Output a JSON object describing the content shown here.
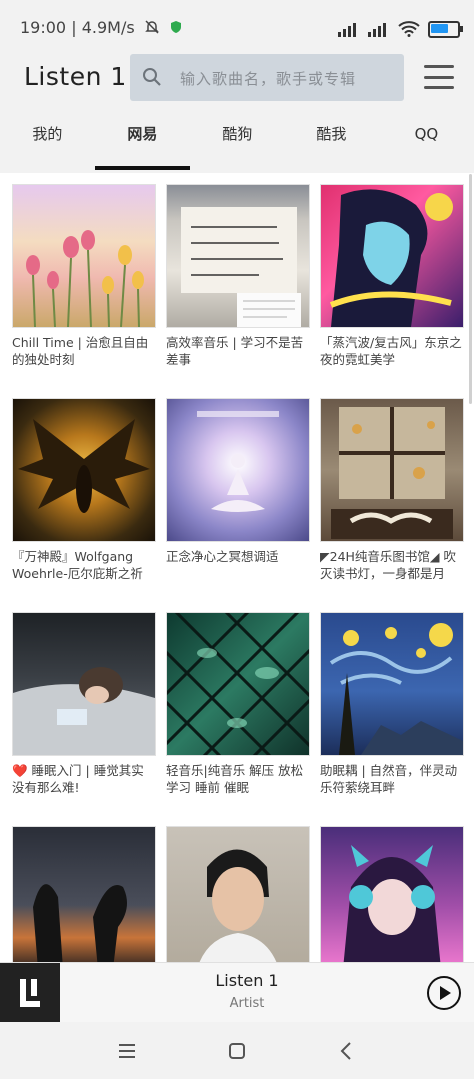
{
  "status": {
    "time": "19:00",
    "speed": "4.9M/s",
    "battery_level": 0.7
  },
  "header": {
    "title": "Listen 1",
    "search_placeholder": "输入歌曲名，歌手或专辑"
  },
  "tabs": [
    "我的",
    "网易",
    "酷狗",
    "酷我",
    "QQ"
  ],
  "active_tab": "网易",
  "playlists": [
    {
      "title": "Chill Time | 治愈且自由的独处时刻",
      "icon": "tulip-field"
    },
    {
      "title": "高效率音乐 | 学习不是苦差事",
      "icon": "handwritten-note"
    },
    {
      "title": "「蒸汽波/复古风」东京之夜的霓虹美学",
      "icon": "retro-anime-girl"
    },
    {
      "title": "『万神殿』Wolfgang Woehrle-厄尔庇斯之祈",
      "icon": "winged-figure"
    },
    {
      "title": "正念净心之冥想调适",
      "icon": "meditation"
    },
    {
      "title": "◤24H纯音乐图书馆◢ 吹灭读书灯，一身都是月",
      "icon": "window-books"
    },
    {
      "title": "❤️ 睡眠入门 | 睡觉其实没有那么难!",
      "icon": "sleeping-girl"
    },
    {
      "title": "轻音乐|纯音乐 解压 放松 学习 睡前 催眠",
      "icon": "leaf-lattice"
    },
    {
      "title": "助眠耦 | 自然音，伴灵动乐符萦绕耳畔",
      "icon": "starry-night"
    },
    {
      "title": "",
      "icon": "sunset-silhouette"
    },
    {
      "title": "",
      "icon": "singer-portrait"
    },
    {
      "title": "",
      "icon": "anime-headphones"
    }
  ],
  "player": {
    "title": "Listen 1",
    "artist": "Artist"
  },
  "colors": {
    "accent": "#2196f3",
    "search_bg": "#cfd6dd",
    "tab_indicator": "#111111"
  }
}
